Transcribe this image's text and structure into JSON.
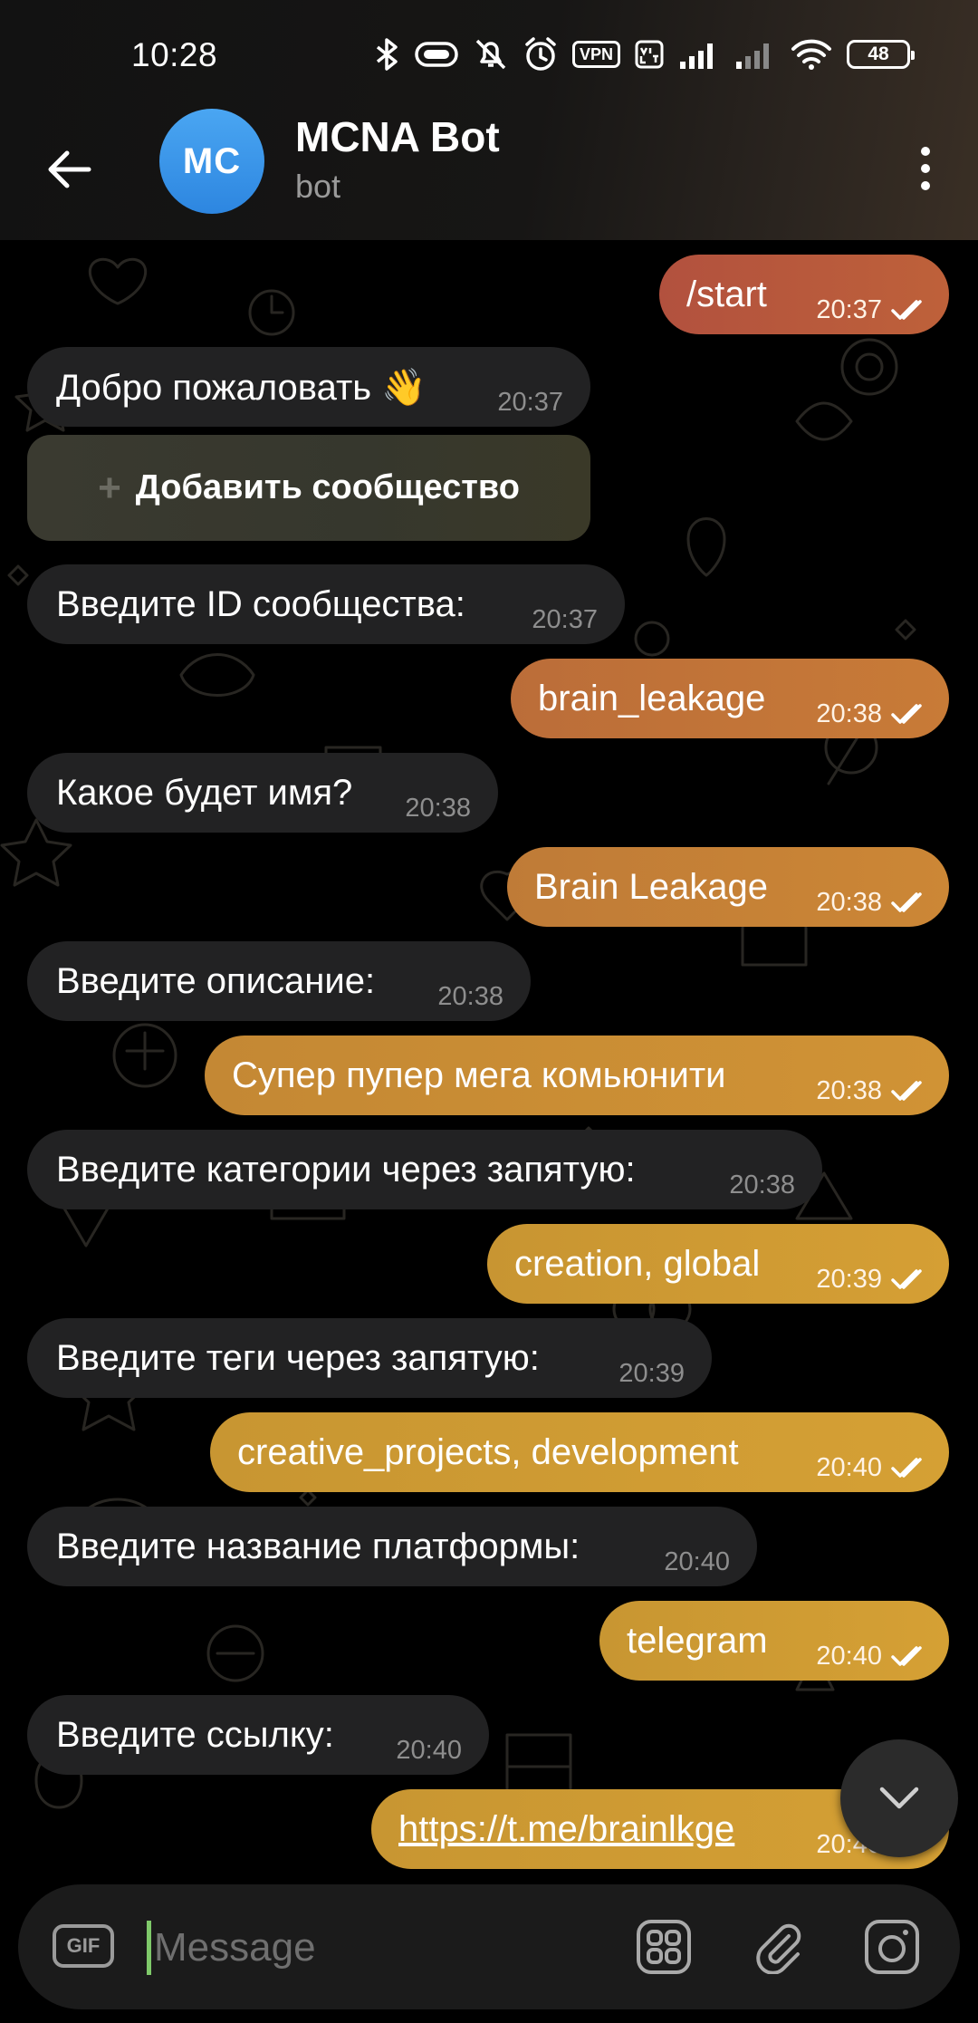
{
  "status_bar": {
    "time": "10:28",
    "vpn": "VPN",
    "battery": "48"
  },
  "header": {
    "avatar_initials": "MC",
    "title": "MCNA Bot",
    "subtitle": "bot"
  },
  "inline_keyboard": {
    "button_label": "Добавить сообщество"
  },
  "messages": [
    {
      "dir": "out",
      "text": "/start",
      "time": "20:37"
    },
    {
      "dir": "in",
      "text": "Добро пожаловать 👋",
      "time": "20:37"
    },
    {
      "dir": "in",
      "text": "Введите ID сообщества:",
      "time": "20:37"
    },
    {
      "dir": "out",
      "text": "brain_leakage",
      "time": "20:38"
    },
    {
      "dir": "in",
      "text": "Какое будет имя?",
      "time": "20:38"
    },
    {
      "dir": "out",
      "text": "Brain Leakage",
      "time": "20:38"
    },
    {
      "dir": "in",
      "text": "Введите описание:",
      "time": "20:38"
    },
    {
      "dir": "out",
      "text": "Супер пупер мега комьюнити",
      "time": "20:38"
    },
    {
      "dir": "in",
      "text": "Введите категории через запятую:",
      "time": "20:38"
    },
    {
      "dir": "out",
      "text": "creation, global",
      "time": "20:39"
    },
    {
      "dir": "in",
      "text": "Введите теги через запятую:",
      "time": "20:39"
    },
    {
      "dir": "out",
      "text": "creative_projects, development",
      "time": "20:40"
    },
    {
      "dir": "in",
      "text": "Введите название платформы:",
      "time": "20:40"
    },
    {
      "dir": "out",
      "text": "telegram",
      "time": "20:40"
    },
    {
      "dir": "in",
      "text": "Введите ссылку:",
      "time": "20:40"
    },
    {
      "dir": "out",
      "text": "https://t.me/brainlkge",
      "time": "20:40"
    }
  ],
  "composer": {
    "gif_label": "GIF",
    "placeholder": "Message"
  },
  "icons": {
    "back": "arrow-left-icon",
    "menu": "more-vertical-icon",
    "scroll": "chevron-down-icon",
    "stickers": "sticker-grid-icon",
    "attach": "paperclip-icon",
    "camera": "camera-icon"
  },
  "colors": {
    "avatar": "#3d96e8",
    "incoming_bubble": "#222223",
    "outgoing_top": "#b5533f",
    "outgoing_bottom": "#d29a35"
  }
}
